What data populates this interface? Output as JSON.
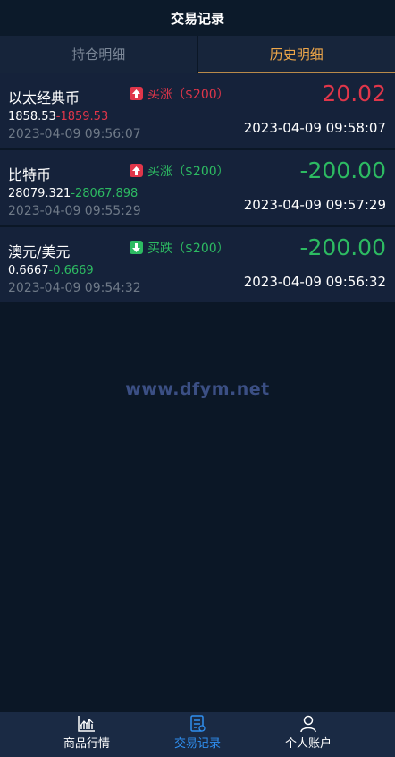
{
  "header": {
    "title": "交易记录"
  },
  "tabs": [
    {
      "label": "持仓明细",
      "active": false
    },
    {
      "label": "历史明细",
      "active": true
    }
  ],
  "records": [
    {
      "name": "以太经典币",
      "direction": "买涨（$200）",
      "direction_type": "up",
      "open_price": "1858.53",
      "close_price": "-1859.53",
      "open_time": "2023-04-09 09:56:07",
      "pnl": "20.02",
      "pnl_type": "red",
      "close_time": "2023-04-09 09:58:07"
    },
    {
      "name": "比特币",
      "direction": "买涨（$200）",
      "direction_type": "up",
      "open_price": "28079.321",
      "close_price": "-28067.898",
      "open_time": "2023-04-09 09:55:29",
      "pnl": "-200.00",
      "pnl_type": "green",
      "close_time": "2023-04-09 09:57:29"
    },
    {
      "name": "澳元/美元",
      "direction": "买跌（$200）",
      "direction_type": "down",
      "open_price": "0.6667",
      "close_price": "-0.6669",
      "open_time": "2023-04-09 09:54:32",
      "pnl": "-200.00",
      "pnl_type": "green",
      "close_time": "2023-04-09 09:56:32"
    }
  ],
  "watermark": "www.dfym.net",
  "nav": [
    {
      "label": "商品行情",
      "icon": "chart-icon",
      "active": false
    },
    {
      "label": "交易记录",
      "icon": "document-icon",
      "active": true
    },
    {
      "label": "个人账户",
      "icon": "user-icon",
      "active": false
    }
  ],
  "colors": {
    "background": "#0b1726",
    "row": "#15223a",
    "up_red": "#e0364a",
    "down_green": "#2dbb62",
    "tab_active": "#f0a84a",
    "nav_active": "#2f8ff0"
  }
}
